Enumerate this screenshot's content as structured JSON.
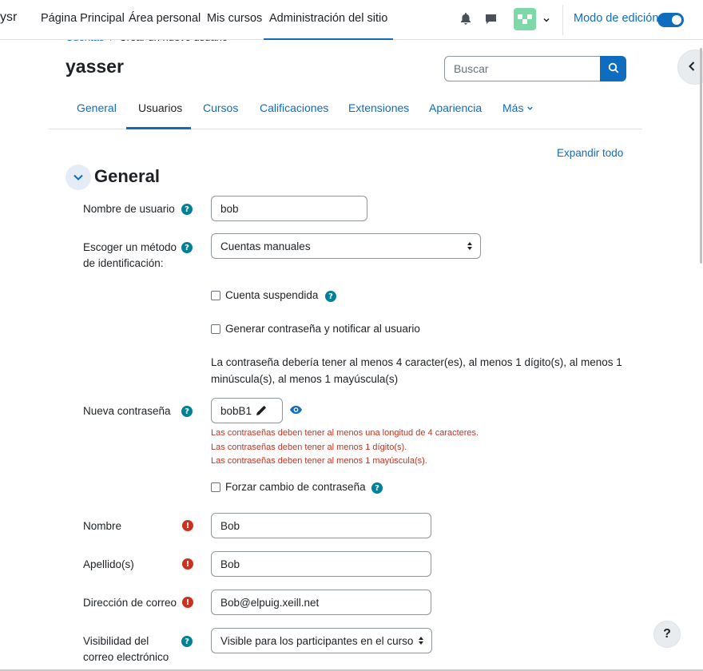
{
  "navbar": {
    "brand": "ysr",
    "items": [
      "Página Principal",
      "Área personal",
      "Mis cursos",
      "Administración del sitio"
    ],
    "active_index": 3,
    "notifications_icon": "bell-icon",
    "messages_icon": "chat-bubble-icon",
    "edit_mode_label": "Modo de edición",
    "edit_mode_on": true
  },
  "breadcrumb": {
    "parent": "Cuentas",
    "separator": "/",
    "current": "Crear un nuevo usuario"
  },
  "page": {
    "title": "yasser"
  },
  "search": {
    "placeholder": "Buscar"
  },
  "tabs": [
    "General",
    "Usuarios",
    "Cursos",
    "Calificaciones",
    "Extensiones",
    "Apariencia",
    "Más"
  ],
  "active_tab": "Usuarios",
  "expand_all": "Expandir todo",
  "section": {
    "title": "General"
  },
  "form": {
    "username_label": "Nombre de usuario",
    "username_value": "bob",
    "auth_label_1": "Escoger un método",
    "auth_label_2": "de identificación:",
    "auth_value": "Cuentas manuales",
    "suspended_label": "Cuenta suspendida",
    "generate_pw_label": "Generar contraseña y notificar al usuario",
    "pw_policy_1": "La contraseña debería tener al menos 4 caracter(es), al menos 1 dígito(s), al menos 1",
    "pw_policy_2": "minúscula(s), al menos 1 mayúscula(s)",
    "new_pw_label": "Nueva contraseña",
    "new_pw_value": "bobB1",
    "errors": [
      "Las contraseñas deben tener al menos una longitud de 4 caracteres.",
      "Las contraseñas deben tener al menos 1 dígito(s).",
      "Las contraseñas deben tener al menos 1 mayúscula(s)."
    ],
    "force_change_label": "Forzar cambio de contraseña",
    "firstname_label": "Nombre",
    "firstname_value": "Bob",
    "lastname_label": "Apellido(s)",
    "lastname_value": "Bob",
    "email_label": "Dirección de correo",
    "email_value": "Bob@elpuig.xeill.net",
    "email_visibility_label_1": "Visibilidad del",
    "email_visibility_label_2": "correo electrónico",
    "email_visibility_value": "Visible para los participantes en el curso"
  },
  "help_fab": "?",
  "colors": {
    "primary": "#0f6cbf",
    "danger": "#ca3120",
    "info": "#008196",
    "text": "#1d2125"
  }
}
